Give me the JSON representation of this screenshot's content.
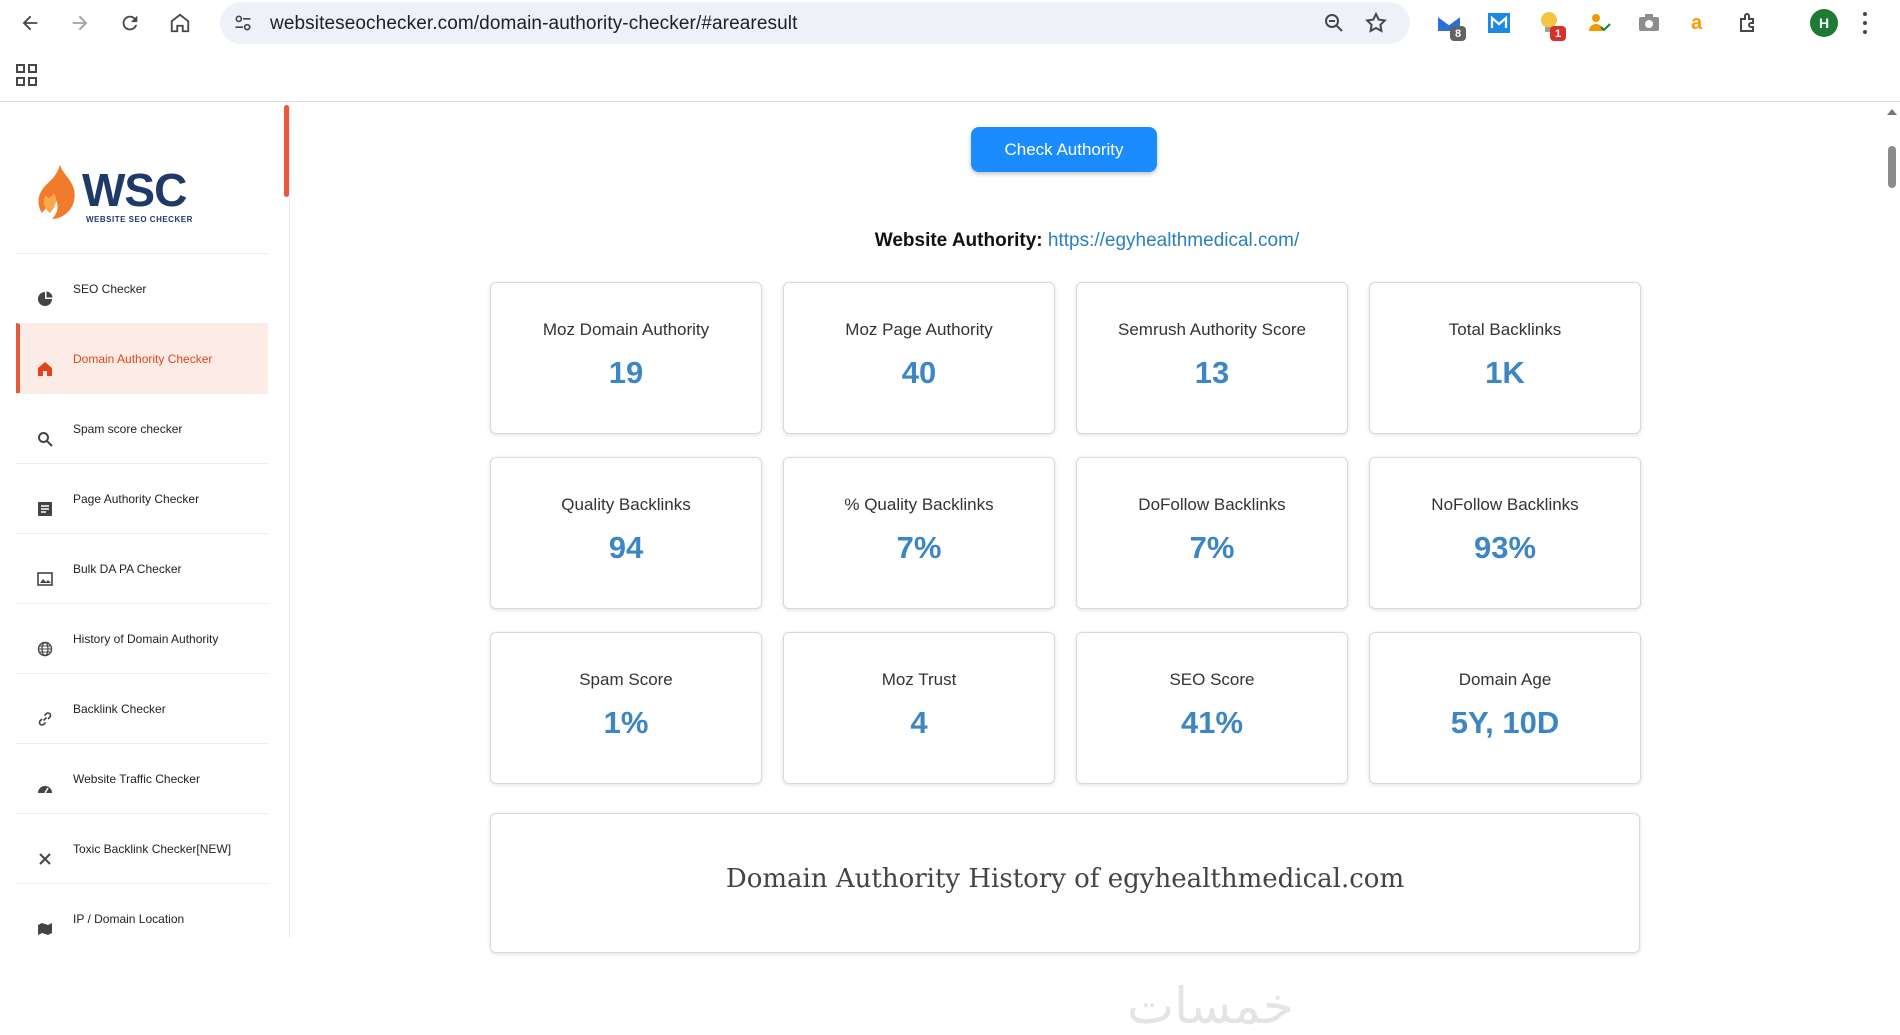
{
  "browser": {
    "url": "websiteseochecker.com/domain-authority-checker/#arearesult",
    "extensions": [
      {
        "name": "gmail-ext-icon",
        "badge": "8",
        "badge_color": "#5f6368"
      },
      {
        "name": "mail-ext-icon",
        "badge": "",
        "badge_color": ""
      },
      {
        "name": "bulb-ext-icon",
        "badge": "1",
        "badge_color": "#d93025"
      },
      {
        "name": "person-check-ext-icon",
        "badge": "",
        "badge_color": ""
      },
      {
        "name": "camera-ext-icon",
        "badge": "",
        "badge_color": ""
      },
      {
        "name": "amazon-ext-icon",
        "badge": "",
        "badge_color": ""
      },
      {
        "name": "puzzle-ext-icon",
        "badge": "",
        "badge_color": ""
      }
    ],
    "profile_initial": "H"
  },
  "logo": {
    "text": "WSC",
    "subtitle": "WEBSITE SEO CHECKER"
  },
  "sidebar": {
    "items": [
      {
        "label": "SEO Checker",
        "icon": "pie-chart-icon"
      },
      {
        "label": "Domain Authority Checker",
        "icon": "home-icon"
      },
      {
        "label": "Spam score checker",
        "icon": "search-icon"
      },
      {
        "label": "Page Authority Checker",
        "icon": "document-icon"
      },
      {
        "label": "Bulk DA PA Checker",
        "icon": "image-icon"
      },
      {
        "label": "History of Domain Authority",
        "icon": "globe-icon"
      },
      {
        "label": "Backlink Checker",
        "icon": "link-icon"
      },
      {
        "label": "Website Traffic Checker",
        "icon": "speedometer-icon"
      },
      {
        "label": "Toxic Backlink Checker[NEW]",
        "icon": "x-icon"
      },
      {
        "label": "IP / Domain Location",
        "icon": "map-icon"
      }
    ]
  },
  "main": {
    "check_button": "Check Authority",
    "website_authority_label": "Website Authority:",
    "website_url": "https://egyhealthmedical.com/",
    "cards": [
      {
        "label": "Moz Domain Authority",
        "value": "19"
      },
      {
        "label": "Moz Page Authority",
        "value": "40"
      },
      {
        "label": "Semrush Authority Score",
        "value": "13"
      },
      {
        "label": "Total Backlinks",
        "value": "1K"
      },
      {
        "label": "Quality Backlinks",
        "value": "94"
      },
      {
        "label": "% Quality Backlinks",
        "value": "7%"
      },
      {
        "label": "DoFollow Backlinks",
        "value": "7%"
      },
      {
        "label": "NoFollow Backlinks",
        "value": "93%"
      },
      {
        "label": "Spam Score",
        "value": "1%"
      },
      {
        "label": "Moz Trust",
        "value": "4"
      },
      {
        "label": "SEO Score",
        "value": "41%"
      },
      {
        "label": "Domain Age",
        "value": "5Y, 10D"
      }
    ],
    "history_title": "Domain Authority History of egyhealthmedical.com"
  },
  "colors": {
    "accent": "#1a8cff",
    "active": "#e8593a",
    "value": "#3d86c6"
  },
  "watermark": "خمسات"
}
